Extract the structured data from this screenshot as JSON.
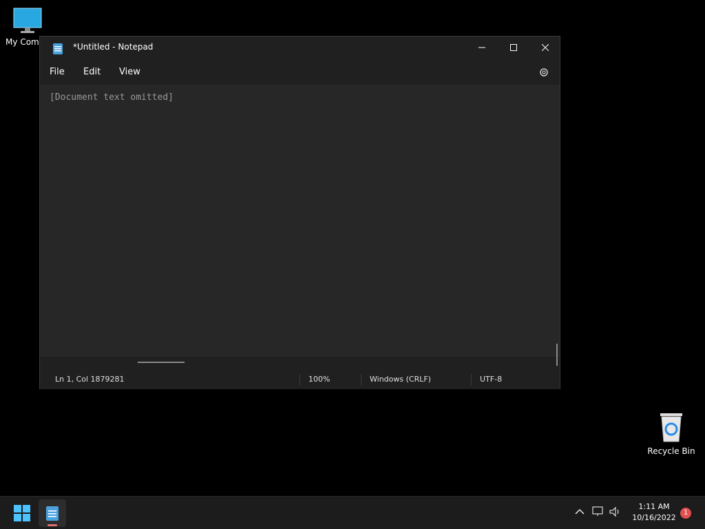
{
  "desktop": {
    "icons": [
      {
        "label": "My Compu"
      },
      {
        "label": "Recycle Bin"
      }
    ]
  },
  "window": {
    "title": "*Untitled - Notepad",
    "menu": {
      "file": "File",
      "edit": "Edit",
      "view": "View"
    },
    "editor_placeholder": "[Document text omitted]",
    "status": {
      "position": "Ln 1, Col 1879281",
      "zoom": "100%",
      "eol": "Windows (CRLF)",
      "encoding": "UTF-8"
    }
  },
  "taskbar": {
    "time": "1:11 AM",
    "date": "10/16/2022",
    "notifications": "1"
  },
  "colors": {
    "accent": "#4cc2ff",
    "badge": "#e05050"
  }
}
